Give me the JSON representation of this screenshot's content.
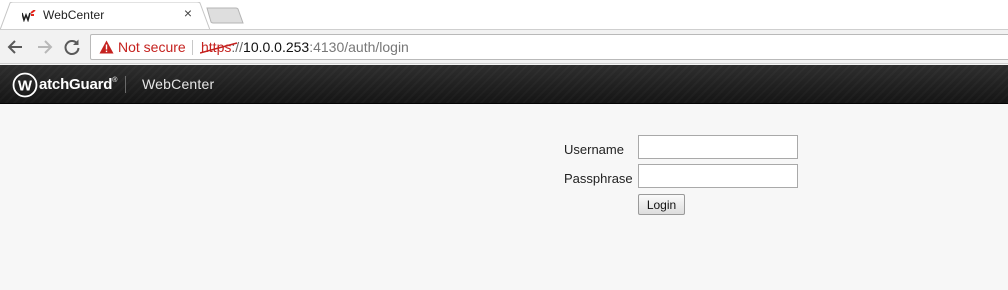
{
  "browser": {
    "tab_title": "WebCenter",
    "tab_close_glyph": "×",
    "security_label": "Not secure",
    "url_scheme": "https",
    "url_separator": "://",
    "url_host": "10.0.0.253",
    "url_rest": ":4130/auth/login",
    "icons": [
      "watchguard-favicon",
      "close-icon",
      "new-tab-icon",
      "back-arrow-icon",
      "forward-arrow-icon",
      "reload-icon",
      "warning-triangle-icon"
    ],
    "colors": {
      "insecure_red": "#c5221f",
      "brand_red": "#e2231a"
    }
  },
  "app": {
    "brand_w": "W",
    "brand_rest": "atchGuard",
    "brand_reg": "®",
    "app_name": "WebCenter",
    "header_color": "#1e1e1e"
  },
  "login": {
    "username_label": "Username",
    "passphrase_label": "Passphrase",
    "username_value": "",
    "passphrase_value": "",
    "submit_label": "Login"
  }
}
